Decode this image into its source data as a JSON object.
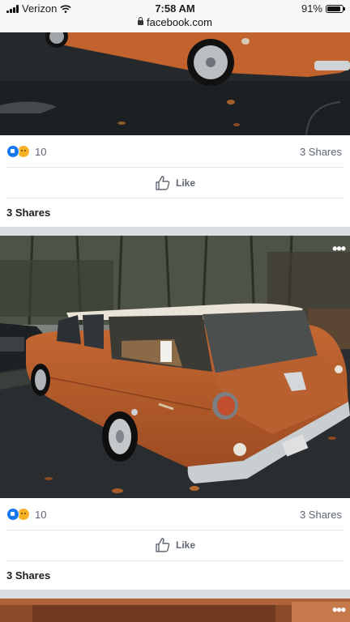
{
  "status": {
    "carrier": "Verizon",
    "time": "7:58 AM",
    "battery": "91%",
    "battery_level": 0.91,
    "url": "facebook.com"
  },
  "posts": [
    {
      "reaction_count": "10",
      "shares": "3 Shares",
      "like_label": "Like",
      "shares_bold": "3 Shares"
    },
    {
      "reaction_count": "10",
      "shares": "3 Shares",
      "like_label": "Like",
      "shares_bold": "3 Shares",
      "more_label": "•••"
    },
    {
      "more_label": "•••"
    }
  ],
  "colors": {
    "car_body": "#c2632e",
    "roof": "#e9e4d7",
    "like_blue": "#1877f2"
  },
  "icons": [
    "signal-icon",
    "wifi-icon",
    "lock-icon",
    "battery-icon",
    "like-reaction-icon",
    "sad-reaction-icon",
    "thumbs-up-icon",
    "more-options-icon"
  ]
}
